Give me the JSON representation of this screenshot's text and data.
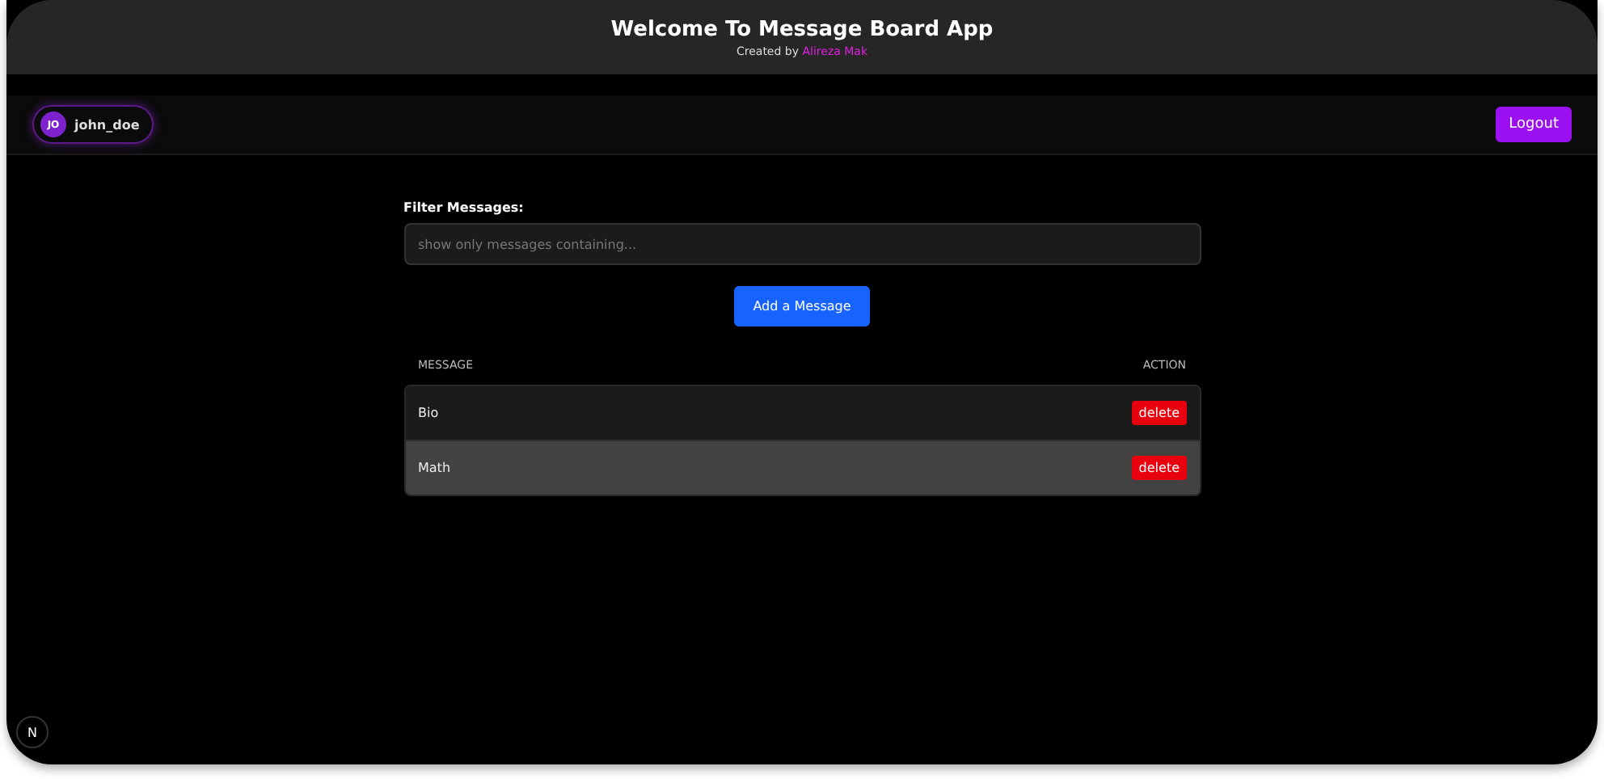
{
  "header": {
    "title": "Welcome To Message Board App",
    "credit_prefix": "Created by",
    "credit_name": "Alireza Mak"
  },
  "navbar": {
    "avatar_initials": "JO",
    "username": "john_doe",
    "logout": "Logout"
  },
  "filter": {
    "label": "Filter Messages:",
    "placeholder": "show only messages containing..."
  },
  "add_button": "Add a Message",
  "table": {
    "columns": [
      "MESSAGE",
      "ACTION"
    ],
    "rows": [
      {
        "message": "Bio",
        "action": "delete",
        "selected": false
      },
      {
        "message": "Math",
        "action": "delete",
        "selected": true
      }
    ]
  },
  "dev_badge": "N"
}
